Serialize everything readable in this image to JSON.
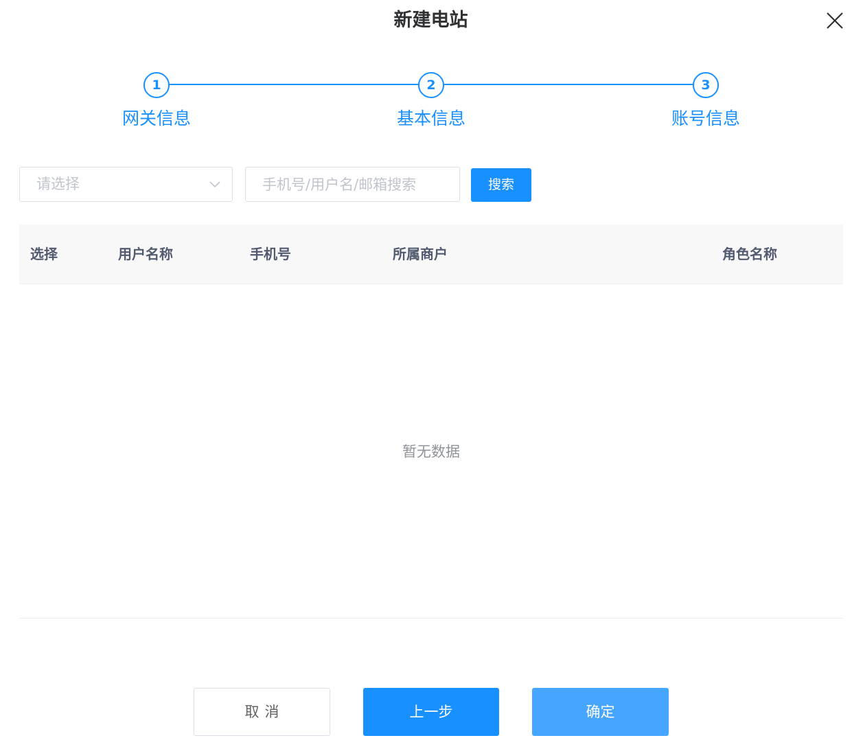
{
  "dialog": {
    "title": "新建电站"
  },
  "steps": [
    {
      "number": "1",
      "label": "网关信息"
    },
    {
      "number": "2",
      "label": "基本信息"
    },
    {
      "number": "3",
      "label": "账号信息"
    }
  ],
  "filters": {
    "select_placeholder": "请选择",
    "search_placeholder": "手机号/用户名/邮箱搜索",
    "search_button": "搜索"
  },
  "table": {
    "columns": [
      "选择",
      "用户名称",
      "手机号",
      "所属商户",
      "角色名称"
    ],
    "empty_text": "暂无数据"
  },
  "footer": {
    "cancel": "取消",
    "prev": "上一步",
    "confirm": "确定"
  },
  "colors": {
    "primary": "#1890ff",
    "primary_light": "#46a6ff",
    "border": "#dcdfe6",
    "header_bg": "#f8f8f9"
  },
  "icons": {
    "close": "close-icon",
    "dropdown": "chevron-down-icon"
  }
}
